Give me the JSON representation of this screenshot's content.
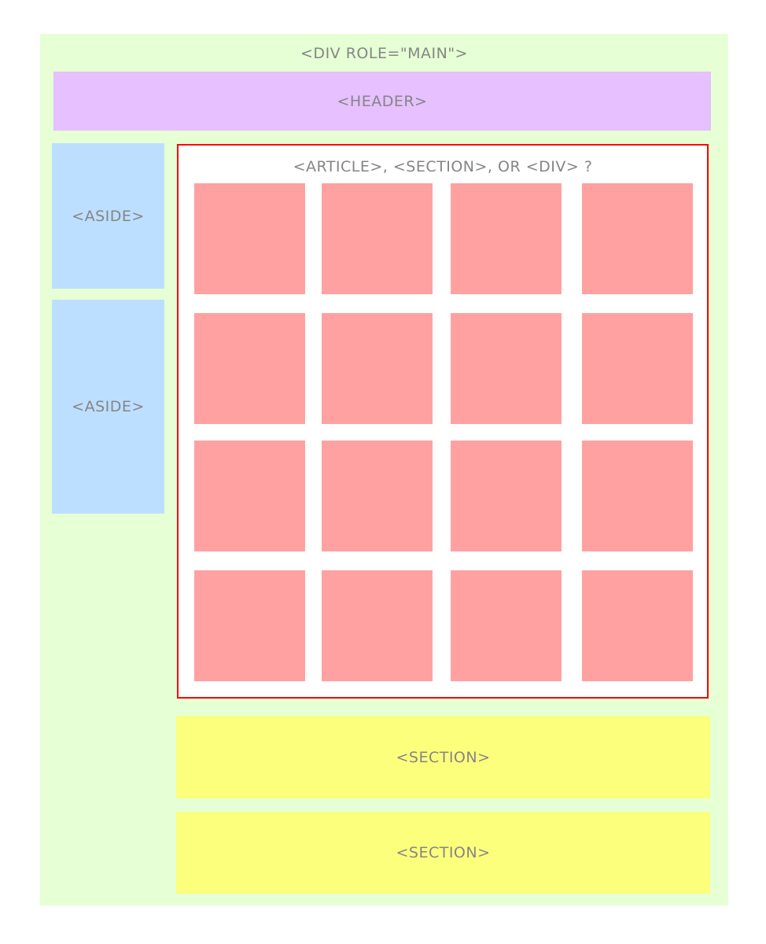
{
  "main": {
    "label": "<div role=\"main\">"
  },
  "header": {
    "label": "<header>"
  },
  "asides": [
    {
      "label": "<aside>"
    },
    {
      "label": "<aside>"
    }
  ],
  "article": {
    "label": "<article>, <section>, or <div> ?",
    "tile_count": 16
  },
  "sections": [
    {
      "label": "<section>"
    },
    {
      "label": "<section>"
    }
  ],
  "colors": {
    "main": "#e6ffd5",
    "header": "#e6c0ff",
    "aside": "#bddfff",
    "tile": "#ffa1a1",
    "section": "#fcff7c",
    "article_border": "#ff0000"
  }
}
